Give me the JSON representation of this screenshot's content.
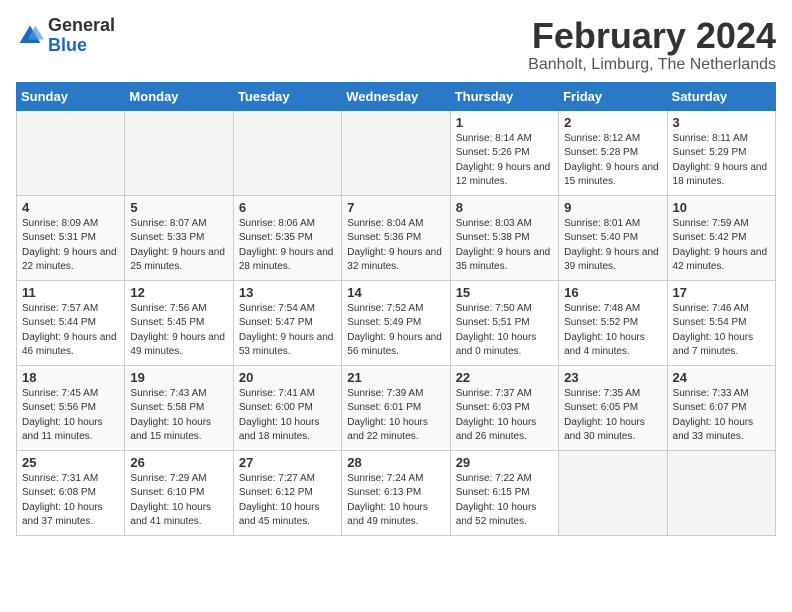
{
  "logo": {
    "general": "General",
    "blue": "Blue"
  },
  "title": "February 2024",
  "location": "Banholt, Limburg, The Netherlands",
  "weekdays": [
    "Sunday",
    "Monday",
    "Tuesday",
    "Wednesday",
    "Thursday",
    "Friday",
    "Saturday"
  ],
  "weeks": [
    [
      {
        "num": "",
        "empty": true
      },
      {
        "num": "",
        "empty": true
      },
      {
        "num": "",
        "empty": true
      },
      {
        "num": "",
        "empty": true
      },
      {
        "num": "1",
        "sunrise": "8:14 AM",
        "sunset": "5:26 PM",
        "daylight": "9 hours and 12 minutes."
      },
      {
        "num": "2",
        "sunrise": "8:12 AM",
        "sunset": "5:28 PM",
        "daylight": "9 hours and 15 minutes."
      },
      {
        "num": "3",
        "sunrise": "8:11 AM",
        "sunset": "5:29 PM",
        "daylight": "9 hours and 18 minutes."
      }
    ],
    [
      {
        "num": "4",
        "sunrise": "8:09 AM",
        "sunset": "5:31 PM",
        "daylight": "9 hours and 22 minutes."
      },
      {
        "num": "5",
        "sunrise": "8:07 AM",
        "sunset": "5:33 PM",
        "daylight": "9 hours and 25 minutes."
      },
      {
        "num": "6",
        "sunrise": "8:06 AM",
        "sunset": "5:35 PM",
        "daylight": "9 hours and 28 minutes."
      },
      {
        "num": "7",
        "sunrise": "8:04 AM",
        "sunset": "5:36 PM",
        "daylight": "9 hours and 32 minutes."
      },
      {
        "num": "8",
        "sunrise": "8:03 AM",
        "sunset": "5:38 PM",
        "daylight": "9 hours and 35 minutes."
      },
      {
        "num": "9",
        "sunrise": "8:01 AM",
        "sunset": "5:40 PM",
        "daylight": "9 hours and 39 minutes."
      },
      {
        "num": "10",
        "sunrise": "7:59 AM",
        "sunset": "5:42 PM",
        "daylight": "9 hours and 42 minutes."
      }
    ],
    [
      {
        "num": "11",
        "sunrise": "7:57 AM",
        "sunset": "5:44 PM",
        "daylight": "9 hours and 46 minutes."
      },
      {
        "num": "12",
        "sunrise": "7:56 AM",
        "sunset": "5:45 PM",
        "daylight": "9 hours and 49 minutes."
      },
      {
        "num": "13",
        "sunrise": "7:54 AM",
        "sunset": "5:47 PM",
        "daylight": "9 hours and 53 minutes."
      },
      {
        "num": "14",
        "sunrise": "7:52 AM",
        "sunset": "5:49 PM",
        "daylight": "9 hours and 56 minutes."
      },
      {
        "num": "15",
        "sunrise": "7:50 AM",
        "sunset": "5:51 PM",
        "daylight": "10 hours and 0 minutes."
      },
      {
        "num": "16",
        "sunrise": "7:48 AM",
        "sunset": "5:52 PM",
        "daylight": "10 hours and 4 minutes."
      },
      {
        "num": "17",
        "sunrise": "7:46 AM",
        "sunset": "5:54 PM",
        "daylight": "10 hours and 7 minutes."
      }
    ],
    [
      {
        "num": "18",
        "sunrise": "7:45 AM",
        "sunset": "5:56 PM",
        "daylight": "10 hours and 11 minutes."
      },
      {
        "num": "19",
        "sunrise": "7:43 AM",
        "sunset": "5:58 PM",
        "daylight": "10 hours and 15 minutes."
      },
      {
        "num": "20",
        "sunrise": "7:41 AM",
        "sunset": "6:00 PM",
        "daylight": "10 hours and 18 minutes."
      },
      {
        "num": "21",
        "sunrise": "7:39 AM",
        "sunset": "6:01 PM",
        "daylight": "10 hours and 22 minutes."
      },
      {
        "num": "22",
        "sunrise": "7:37 AM",
        "sunset": "6:03 PM",
        "daylight": "10 hours and 26 minutes."
      },
      {
        "num": "23",
        "sunrise": "7:35 AM",
        "sunset": "6:05 PM",
        "daylight": "10 hours and 30 minutes."
      },
      {
        "num": "24",
        "sunrise": "7:33 AM",
        "sunset": "6:07 PM",
        "daylight": "10 hours and 33 minutes."
      }
    ],
    [
      {
        "num": "25",
        "sunrise": "7:31 AM",
        "sunset": "6:08 PM",
        "daylight": "10 hours and 37 minutes."
      },
      {
        "num": "26",
        "sunrise": "7:29 AM",
        "sunset": "6:10 PM",
        "daylight": "10 hours and 41 minutes."
      },
      {
        "num": "27",
        "sunrise": "7:27 AM",
        "sunset": "6:12 PM",
        "daylight": "10 hours and 45 minutes."
      },
      {
        "num": "28",
        "sunrise": "7:24 AM",
        "sunset": "6:13 PM",
        "daylight": "10 hours and 49 minutes."
      },
      {
        "num": "29",
        "sunrise": "7:22 AM",
        "sunset": "6:15 PM",
        "daylight": "10 hours and 52 minutes."
      },
      {
        "num": "",
        "empty": true
      },
      {
        "num": "",
        "empty": true
      }
    ]
  ]
}
